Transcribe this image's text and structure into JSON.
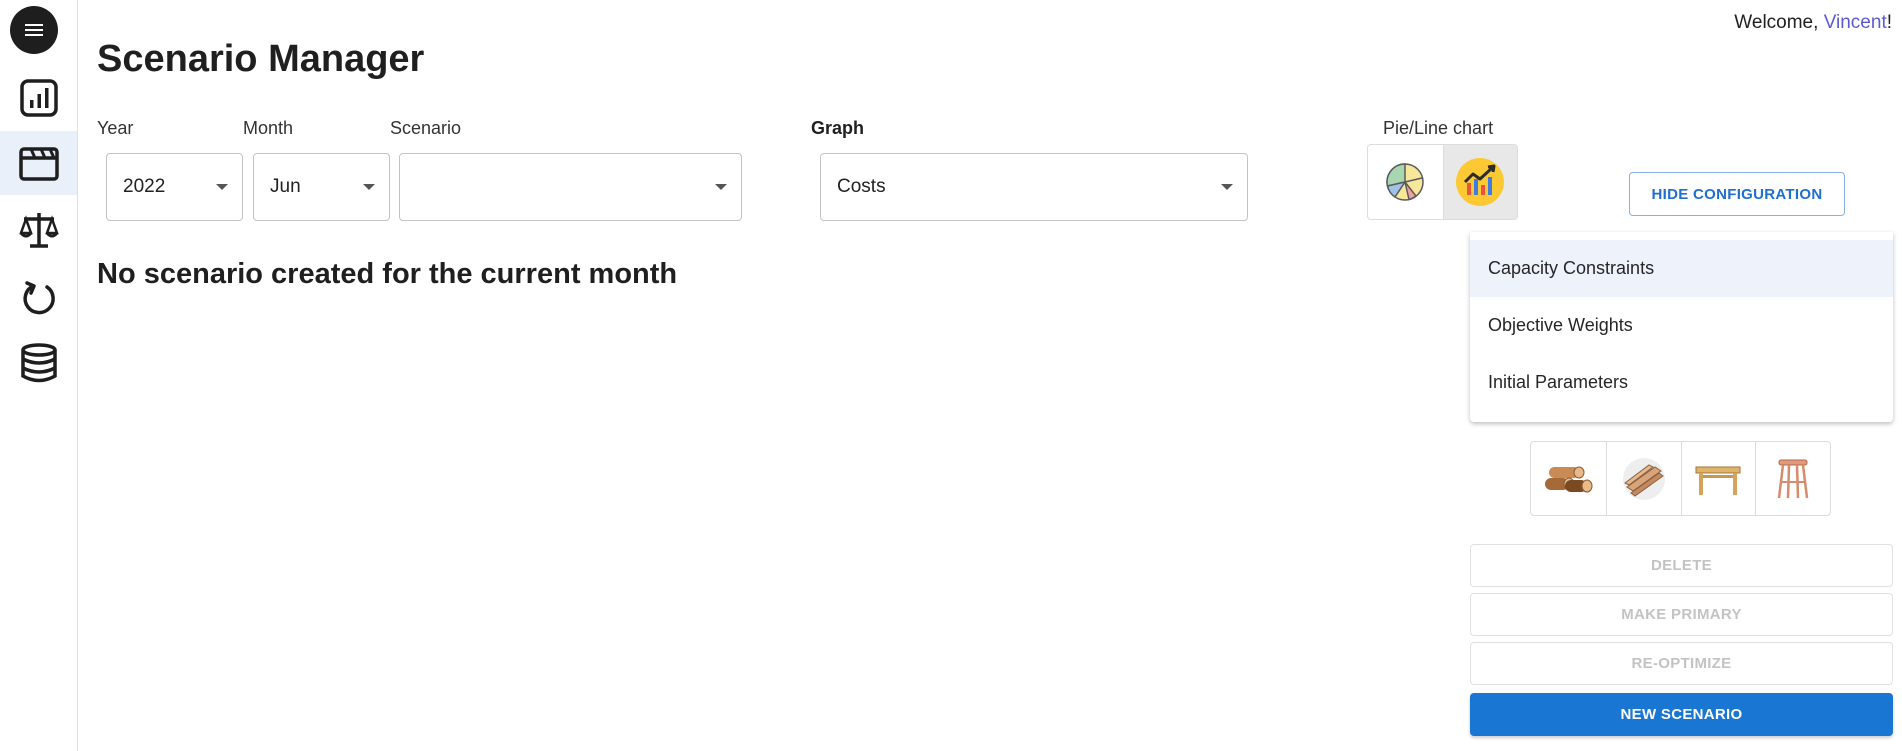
{
  "app": {
    "page_title": "Scenario Manager",
    "welcome_prefix": "Welcome, ",
    "user_name": "Vincent",
    "welcome_suffix": "!"
  },
  "sidebar": {
    "items": [
      {
        "icon": "menu-icon"
      },
      {
        "icon": "dashboard-chart-icon"
      },
      {
        "icon": "clapperboard-icon",
        "active": true
      },
      {
        "icon": "balance-scale-icon"
      },
      {
        "icon": "refresh-cycle-icon"
      },
      {
        "icon": "database-icon"
      }
    ]
  },
  "filters": {
    "year_label": "Year",
    "year_value": "2022",
    "month_label": "Month",
    "month_value": "Jun",
    "scenario_label": "Scenario",
    "scenario_value": "",
    "graph_label": "Graph",
    "graph_value": "Costs",
    "chart_toggle_label": "Pie/Line chart",
    "chart_toggle_selected": "line"
  },
  "config": {
    "hide_button": "HIDE CONFIGURATION",
    "menu_items": [
      "Capacity Constraints",
      "Objective Weights",
      "Initial Parameters"
    ]
  },
  "products": {
    "icons": [
      "logs-icon",
      "planks-icon",
      "table-icon",
      "stool-icon"
    ]
  },
  "main": {
    "empty_message": "No scenario created for the current month"
  },
  "actions": {
    "delete": "DELETE",
    "make_primary": "MAKE PRIMARY",
    "reoptimize": "RE-OPTIMIZE",
    "new_scenario": "NEW SCENARIO"
  },
  "colors": {
    "accent": "#1976d2",
    "user_name": "#5b5bd6",
    "active_nav_bg": "#e9f0fa"
  }
}
